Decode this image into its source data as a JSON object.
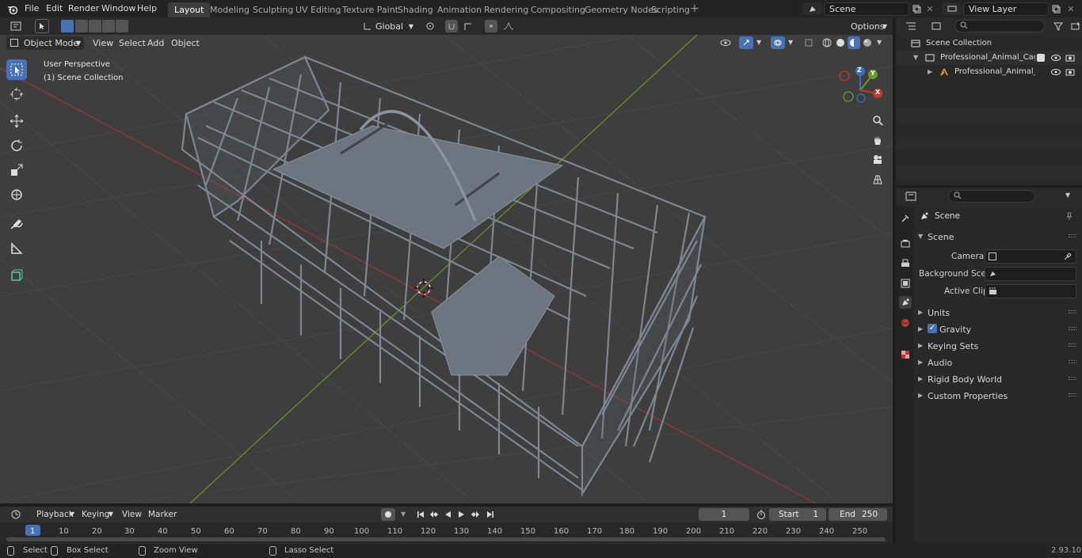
{
  "menu": [
    "File",
    "Edit",
    "Render",
    "Window",
    "Help"
  ],
  "workspaces": [
    "Layout",
    "Modeling",
    "Sculpting",
    "UV Editing",
    "Texture Paint",
    "Shading",
    "Animation",
    "Rendering",
    "Compositing",
    "Geometry Nodes",
    "Scripting"
  ],
  "active_workspace": "Layout",
  "scene_field": "Scene",
  "view_layer_field": "View Layer",
  "viewport": {
    "mode": "Object Mode",
    "header_menus": [
      "View",
      "Select",
      "Add",
      "Object"
    ],
    "orientation": "Global",
    "options_label": "Options",
    "overlay_title": "User Perspective",
    "overlay_subtitle": "(1) Scene Collection"
  },
  "gizmo": {
    "z": "Z",
    "y": "Y",
    "x": "X"
  },
  "outliner": {
    "root": "Scene Collection",
    "items": [
      "Professional_Animal_Cage_Tr",
      "Professional_Animal_Cag"
    ]
  },
  "properties": {
    "context": "Scene",
    "panel": "Scene",
    "fields": [
      {
        "label": "Camera"
      },
      {
        "label": "Background Scene"
      },
      {
        "label": "Active Clip"
      }
    ],
    "subpanels": [
      "Units",
      "Gravity",
      "Keying Sets",
      "Audio",
      "Rigid Body World",
      "Custom Properties"
    ],
    "gravity_checked": true
  },
  "timeline": {
    "menus": [
      "Playback",
      "Keying",
      "View",
      "Marker"
    ],
    "current_frame": "1",
    "start_label": "Start",
    "start_value": "1",
    "end_label": "End",
    "end_value": "250",
    "ticks": [
      "1",
      "10",
      "20",
      "30",
      "40",
      "50",
      "60",
      "70",
      "80",
      "90",
      "100",
      "110",
      "120",
      "130",
      "140",
      "150",
      "160",
      "170",
      "180",
      "190",
      "200",
      "210",
      "220",
      "230",
      "240",
      "250"
    ]
  },
  "status": {
    "select": "Select",
    "box_select": "Box Select",
    "zoom_view": "Zoom View",
    "lasso_select": "Lasso Select",
    "version": "2.93.10"
  },
  "colors": {
    "accent": "#4772b3",
    "x_axis": "#c0392b",
    "y_axis": "#6a9a2a",
    "model": "#7d8791"
  }
}
